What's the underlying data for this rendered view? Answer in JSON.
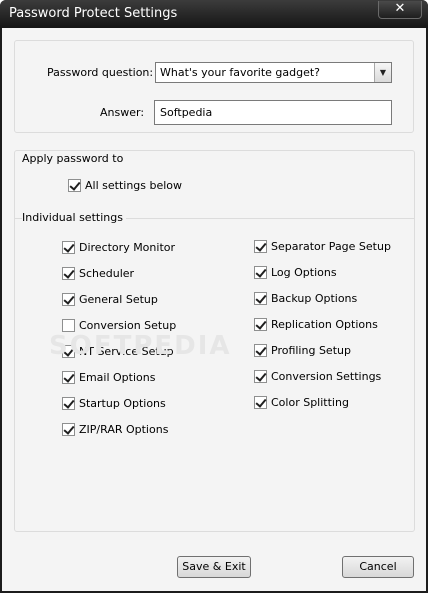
{
  "window": {
    "title": "Password Protect Settings",
    "close_glyph": "✕"
  },
  "question": {
    "label": "Password question:",
    "value": "What's your favorite gadget?",
    "dropdown_glyph": "▼"
  },
  "answer": {
    "label": "Answer:",
    "value": "Softpedia"
  },
  "apply": {
    "title": "Apply password to",
    "all_label": "All settings below",
    "all_checked": true
  },
  "individual": {
    "title": "Individual settings",
    "left": [
      {
        "label": "Directory Monitor",
        "checked": true
      },
      {
        "label": "Scheduler",
        "checked": true
      },
      {
        "label": "General Setup",
        "checked": true
      },
      {
        "label": "Conversion Setup",
        "checked": false
      },
      {
        "label": "NT Service Setup",
        "checked": true
      },
      {
        "label": "Email Options",
        "checked": true
      },
      {
        "label": "Startup Options",
        "checked": true
      },
      {
        "label": "ZIP/RAR Options",
        "checked": true
      }
    ],
    "right": [
      {
        "label": "Separator Page Setup",
        "checked": true
      },
      {
        "label": "Log Options",
        "checked": true
      },
      {
        "label": "Backup Options",
        "checked": true
      },
      {
        "label": "Replication Options",
        "checked": true
      },
      {
        "label": "Profiling Setup",
        "checked": true
      },
      {
        "label": "Conversion Settings",
        "checked": true
      },
      {
        "label": "Color Splitting",
        "checked": true
      }
    ]
  },
  "buttons": {
    "save": "Save & Exit",
    "cancel": "Cancel"
  },
  "watermark": "SOFTPEDIA"
}
